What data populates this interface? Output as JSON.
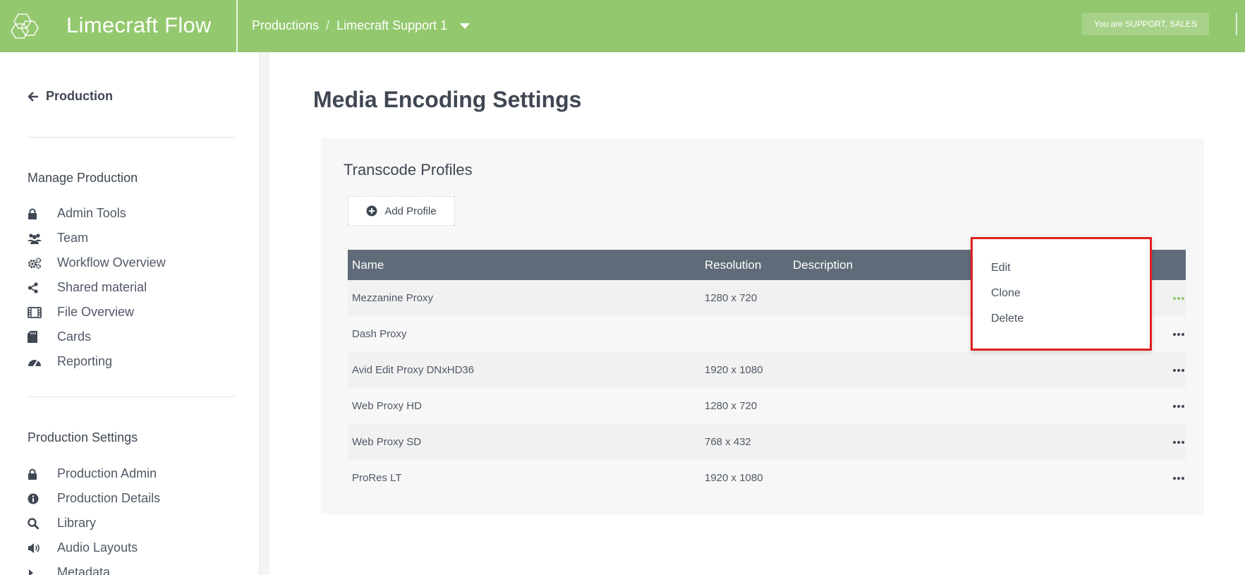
{
  "app": {
    "title": "Limecraft Flow"
  },
  "breadcrumb": {
    "root": "Productions",
    "separator": "/",
    "current": "Limecraft Support 1"
  },
  "user": {
    "role_badge": "You are SUPPORT, SALES"
  },
  "sidebar": {
    "back_label": "Production",
    "manage_heading": "Manage Production",
    "manage_items": [
      {
        "label": "Admin Tools",
        "icon": "lock-icon"
      },
      {
        "label": "Team",
        "icon": "users-icon"
      },
      {
        "label": "Workflow Overview",
        "icon": "cogs-icon"
      },
      {
        "label": "Shared material",
        "icon": "share-icon"
      },
      {
        "label": "File Overview",
        "icon": "film-icon"
      },
      {
        "label": "Cards",
        "icon": "sd-card-icon"
      },
      {
        "label": "Reporting",
        "icon": "dashboard-icon"
      }
    ],
    "settings_heading": "Production Settings",
    "settings_items": [
      {
        "label": "Production Admin",
        "icon": "lock-icon"
      },
      {
        "label": "Production Details",
        "icon": "info-icon"
      },
      {
        "label": "Library",
        "icon": "search-icon"
      },
      {
        "label": "Audio Layouts",
        "icon": "volume-icon"
      },
      {
        "label": "Metadata",
        "icon": "caret-right-icon"
      }
    ]
  },
  "main": {
    "page_title": "Media Encoding Settings",
    "panel_title": "Transcode Profiles",
    "add_button_label": "Add Profile",
    "table": {
      "headers": {
        "name": "Name",
        "resolution": "Resolution",
        "description": "Description"
      },
      "rows": [
        {
          "name": "Mezzanine Proxy",
          "resolution": "1280 x 720",
          "description": ""
        },
        {
          "name": "Dash Proxy",
          "resolution": "",
          "description": ""
        },
        {
          "name": "Avid Edit Proxy DNxHD36",
          "resolution": "1920 x 1080",
          "description": ""
        },
        {
          "name": "Web Proxy HD",
          "resolution": "1280 x 720",
          "description": ""
        },
        {
          "name": "Web Proxy SD",
          "resolution": "768 x 432",
          "description": ""
        },
        {
          "name": "ProRes LT",
          "resolution": "1920 x 1080",
          "description": ""
        }
      ]
    },
    "row_menu": {
      "items": [
        "Edit",
        "Clone",
        "Delete"
      ]
    }
  },
  "colors": {
    "brand_green": "#93c86e",
    "table_header": "#5f6b78",
    "highlight_red": "#e02020"
  }
}
